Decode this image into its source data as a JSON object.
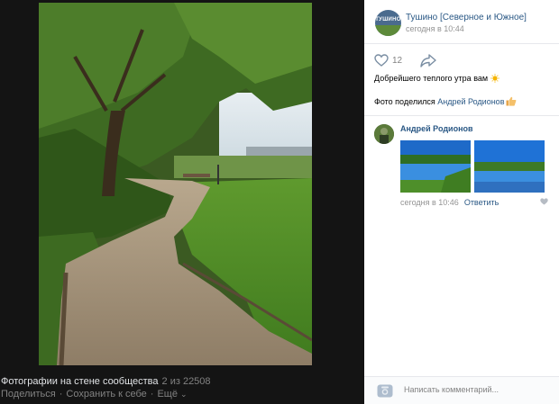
{
  "viewer": {
    "album_caption": "Фотографии на стене сообщества",
    "counter": "2 из 22508",
    "actions": {
      "share": "Поделиться",
      "save": "Сохранить к себе",
      "more": "Ещё"
    }
  },
  "post": {
    "group_avatar_text": "ТУШИНО",
    "group_name": "Тушино [Северное и Южное]",
    "time": "сегодня в 10:44",
    "likes": "12",
    "text": "Добрейшего теплого утра вам",
    "shared_prefix": "Фото поделился",
    "shared_author": "Андрей Родионов"
  },
  "comment": {
    "author": "Андрей Родионов",
    "time": "сегодня в 10:46",
    "reply_label": "Ответить"
  },
  "composer": {
    "placeholder": "Написать комментарий..."
  },
  "colors": {
    "link": "#2a5885",
    "viewer_bg": "#141414",
    "muted": "#828282"
  }
}
